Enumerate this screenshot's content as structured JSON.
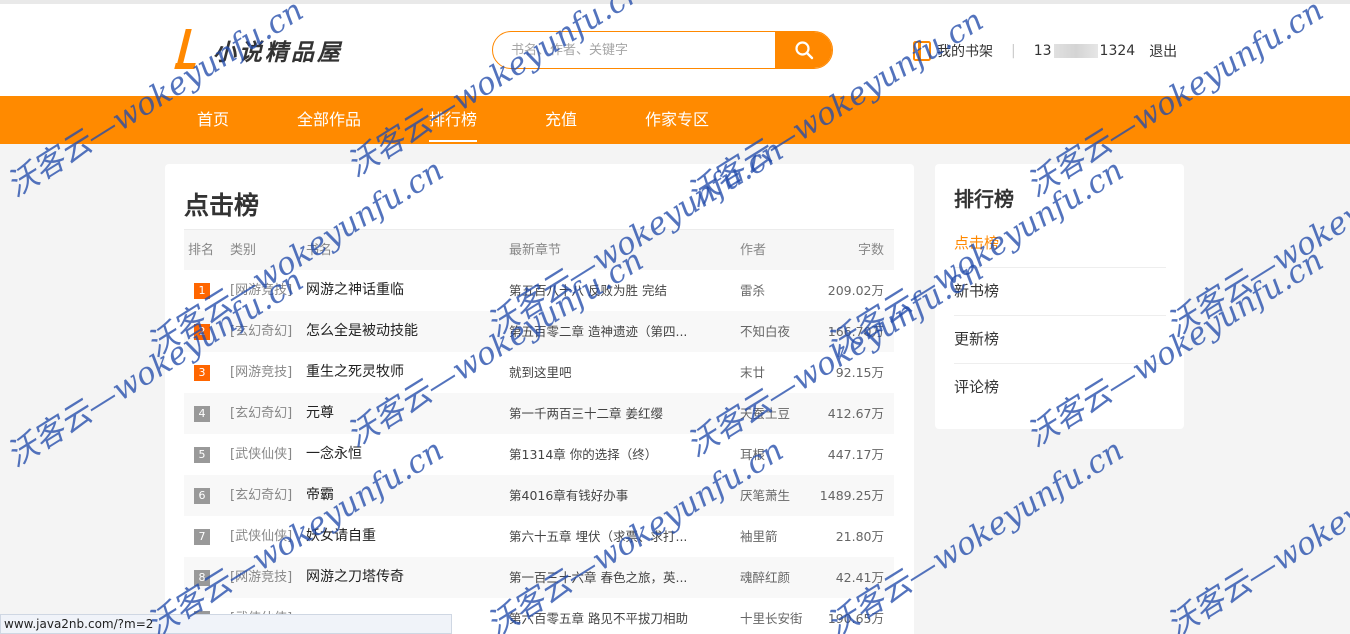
{
  "logo": {
    "text": "小说精品屋"
  },
  "search": {
    "placeholder": "书名、作者、关键字"
  },
  "user": {
    "bookshelf_label": "我的书架",
    "phone_prefix": "13",
    "phone_suffix": "1324",
    "logout_label": "退出"
  },
  "nav": {
    "items": [
      {
        "label": "首页"
      },
      {
        "label": "全部作品"
      },
      {
        "label": "排行榜"
      },
      {
        "label": "充值"
      },
      {
        "label": "作家专区"
      }
    ],
    "active_index": 2
  },
  "ranking": {
    "title": "点击榜",
    "columns": {
      "rank": "排名",
      "category": "类别",
      "name": "书名",
      "chapter": "最新章节",
      "author": "作者",
      "words": "字数"
    },
    "rows": [
      {
        "rank": "1",
        "category": "[网游竞技]",
        "name": "网游之神话重临",
        "chapter": "第五百八十八 反败为胜 完结",
        "author": "雷杀",
        "words": "209.02万"
      },
      {
        "rank": "2",
        "category": "[玄幻奇幻]",
        "name": "怎么全是被动技能",
        "chapter": "第五百零二章 造神遗迹（第四...",
        "author": "不知白夜",
        "words": "166.70万"
      },
      {
        "rank": "3",
        "category": "[网游竞技]",
        "name": "重生之死灵牧师",
        "chapter": "就到这里吧",
        "author": "末廿",
        "words": "92.15万"
      },
      {
        "rank": "4",
        "category": "[玄幻奇幻]",
        "name": "元尊",
        "chapter": "第一千两百三十二章 姜红缨",
        "author": "天蚕土豆",
        "words": "412.67万"
      },
      {
        "rank": "5",
        "category": "[武侠仙侠]",
        "name": "一念永恒",
        "chapter": "第1314章 你的选择（终）",
        "author": "耳根",
        "words": "447.17万"
      },
      {
        "rank": "6",
        "category": "[玄幻奇幻]",
        "name": "帝霸",
        "chapter": "第4016章有钱好办事",
        "author": "厌笔萧生",
        "words": "1489.25万"
      },
      {
        "rank": "7",
        "category": "[武侠仙侠]",
        "name": "妖女请自重",
        "chapter": "第六十五章 埋伏（求票、求打...",
        "author": "袖里箭",
        "words": "21.80万"
      },
      {
        "rank": "8",
        "category": "[网游竞技]",
        "name": "网游之刀塔传奇",
        "chapter": "第一百三十六章 春色之旅，英...",
        "author": "魂醉红颜",
        "words": "42.41万"
      },
      {
        "rank": "9",
        "category": "[武侠仙侠]",
        "name": "",
        "chapter": "第六百零五章 路见不平拔刀相助",
        "author": "十里长安街",
        "words": "190.65万"
      }
    ]
  },
  "sidebar": {
    "title": "排行榜",
    "items": [
      {
        "label": "点击榜"
      },
      {
        "label": "新书榜"
      },
      {
        "label": "更新榜"
      },
      {
        "label": "评论榜"
      }
    ],
    "active_index": 0
  },
  "status_bar": {
    "url": "www.java2nb.com/?m=2"
  },
  "watermark": {
    "text": "沃客云—wokeyunfu.cn"
  },
  "colors": {
    "accent": "#ff8800",
    "rank_top": "#ff6600",
    "rank_other": "#999999"
  }
}
